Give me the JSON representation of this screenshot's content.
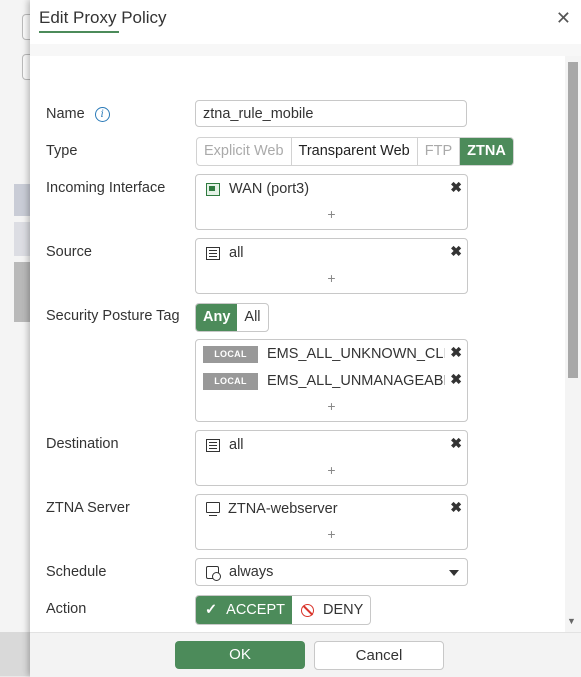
{
  "dialog": {
    "title": "Edit Proxy Policy",
    "close_label": "✕"
  },
  "form": {
    "name": {
      "label": "Name",
      "value": "ztna_rule_mobile"
    },
    "type": {
      "label": "Type",
      "options": [
        "Explicit Web",
        "Transparent Web",
        "FTP",
        "ZTNA"
      ],
      "selected": "ZTNA"
    },
    "incoming_interface": {
      "label": "Incoming Interface",
      "items": [
        "WAN (port3)"
      ]
    },
    "source": {
      "label": "Source",
      "items": [
        "all"
      ]
    },
    "security_posture_tag": {
      "label": "Security Posture Tag",
      "toggle": [
        "Any",
        "All"
      ],
      "selected": "Any",
      "tag_label": "LOCAL",
      "items": [
        "EMS_ALL_UNKNOWN_CLIENTS",
        "EMS_ALL_UNMANAGEABLE_CLIENTS"
      ]
    },
    "destination": {
      "label": "Destination",
      "items": [
        "all"
      ]
    },
    "ztna_server": {
      "label": "ZTNA Server",
      "items": [
        "ZTNA-webserver"
      ]
    },
    "schedule": {
      "label": "Schedule",
      "value": "always"
    },
    "action": {
      "label": "Action",
      "accept": "ACCEPT",
      "deny": "DENY",
      "selected": "ACCEPT"
    },
    "plus_symbol": "+",
    "remove_symbol": "✖"
  },
  "footer": {
    "ok": "OK",
    "cancel": "Cancel"
  },
  "colors": {
    "accent": "#4c8b5a",
    "deny": "#d9342b",
    "info": "#2a7ab8"
  }
}
